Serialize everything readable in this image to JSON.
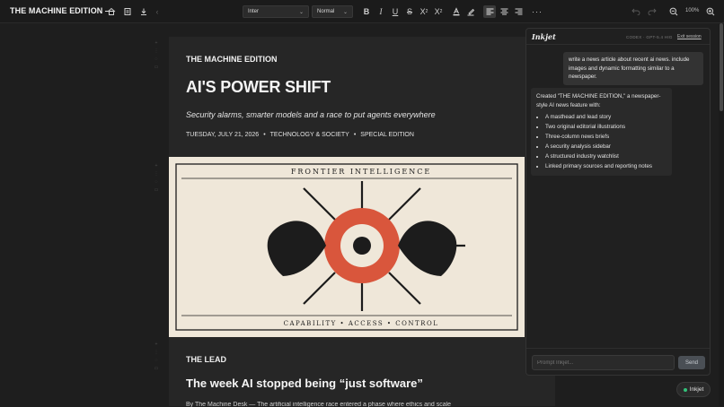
{
  "app": {
    "title": "THE MACHINE EDITION —"
  },
  "toolbar": {
    "font_family": "Inter",
    "block_style": "Normal",
    "zoom": "100%",
    "icons": [
      "home-icon",
      "save-icon",
      "download-icon",
      "undo-icon",
      "redo-icon",
      "zoom-out-icon",
      "zoom-in-icon"
    ]
  },
  "document": {
    "kicker": "THE MACHINE EDITION",
    "headline": "AI'S POWER SHIFT",
    "subheadline": "Security alarms, smarter models and a race to put agents everywhere",
    "date": "TUESDAY, JULY 21, 2026",
    "section": "TECHNOLOGY & SOCIETY",
    "edition": "SPECIAL EDITION",
    "illustration": {
      "top_caption": "FRONTIER INTELLIGENCE",
      "bottom_caption": "CAPABILITY • ACCESS • CONTROL",
      "colors": {
        "paper": "#efe7d9",
        "ink": "#1c1c1c",
        "accent": "#d9563c"
      }
    },
    "lead_label": "THE LEAD",
    "lead_title": "The week AI stopped being “just software”",
    "lead_body": "By The Machine Desk — The artificial intelligence race entered a phase where ethics and scale"
  },
  "panel": {
    "logo": "Inkjet",
    "model": "CODEX · GPT-5.4 HIG",
    "exit_label": "Exit session",
    "user_message": "write a news article about recent ai news. include images and dynamic formatting similar to a newspaper.",
    "assistant_intro": "Created \"THE MACHINE EDITION,\" a newspaper-style AI news feature with:",
    "assistant_items": [
      "A masthead and lead story",
      "Two original editorial illustrations",
      "Three-column news briefs",
      "A security analysis sidebar",
      "A structured industry watchlist",
      "Linked primary sources and reporting notes"
    ],
    "prompt_placeholder": "Prompt Inkjet...",
    "send_label": "Send"
  },
  "fab": {
    "label": "Inkjet",
    "status_color": "#33c27a"
  }
}
